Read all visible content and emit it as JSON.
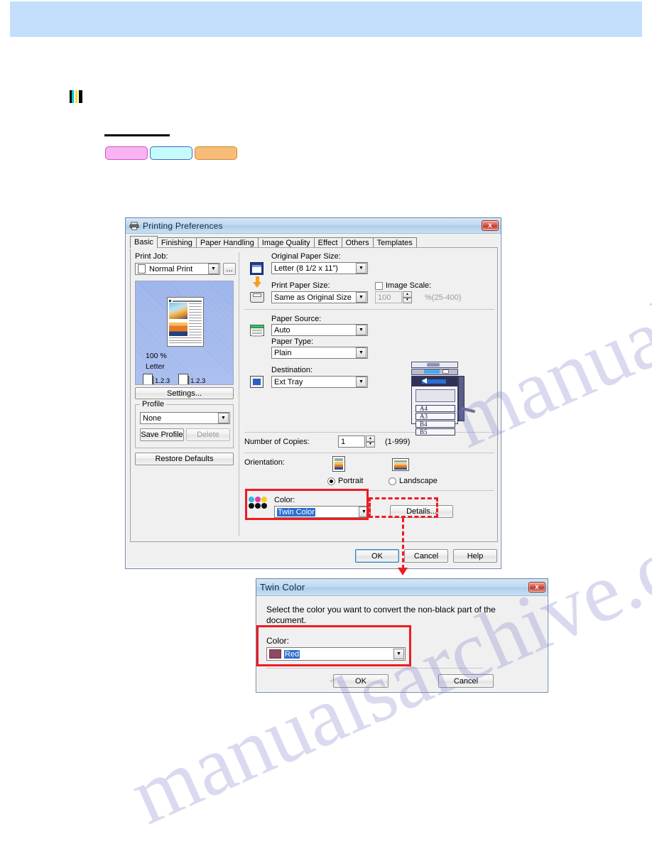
{
  "page": {
    "watermark": "manualsarchive.com",
    "cmyk_marker_colors": [
      "#00c2e0",
      "#f5e12a",
      "#000000",
      "#000000"
    ],
    "pills": [
      {
        "name": "pill-magenta",
        "fill": "#f8b3f2",
        "stroke": "#cf52c6"
      },
      {
        "name": "pill-cyan",
        "fill": "#c6fbfb",
        "stroke": "#4169c9"
      },
      {
        "name": "pill-orange",
        "fill": "#f7bd78",
        "stroke": "#d4872f"
      }
    ],
    "banner_color": "#c3dffb"
  },
  "printing_preferences": {
    "title": "Printing Preferences",
    "close_label": "x",
    "tabs": [
      {
        "label": "Basic",
        "active": true
      },
      {
        "label": "Finishing",
        "active": false
      },
      {
        "label": "Paper Handling",
        "active": false
      },
      {
        "label": "Image Quality",
        "active": false
      },
      {
        "label": "Effect",
        "active": false
      },
      {
        "label": "Others",
        "active": false
      },
      {
        "label": "Templates",
        "active": false
      }
    ],
    "print_job": {
      "label": "Print Job:",
      "value": "Normal Print",
      "more_button": "..."
    },
    "preview": {
      "zoom": "100 %",
      "paper": "Letter",
      "page_order_left": "1.2.3",
      "page_order_right": "1.2.3"
    },
    "settings_button": "Settings...",
    "profile": {
      "group_label": "Profile",
      "value": "None",
      "save_button": "Save Profile",
      "delete_button": "Delete"
    },
    "restore_defaults_button": "Restore Defaults",
    "original_paper_size": {
      "label": "Original Paper Size:",
      "value": "Letter (8 1/2 x 11\")"
    },
    "print_paper_size": {
      "label": "Print Paper Size:",
      "value": "Same as Original Size"
    },
    "image_scale": {
      "label": "Image Scale:",
      "checked": false,
      "value": "100",
      "range": "%(25-400)"
    },
    "paper_source": {
      "label": "Paper Source:",
      "value": "Auto"
    },
    "paper_type": {
      "label": "Paper Type:",
      "value": "Plain"
    },
    "destination": {
      "label": "Destination:",
      "value": "Ext Tray"
    },
    "printer_trays": [
      "A4",
      "A3",
      "B4",
      "B5"
    ],
    "number_of_copies": {
      "label": "Number of Copies:",
      "value": "1",
      "range": "(1-999)"
    },
    "orientation": {
      "label": "Orientation:",
      "portrait": "Portrait",
      "landscape": "Landscape",
      "selected": "Portrait"
    },
    "color": {
      "label": "Color:",
      "value": "Twin Color",
      "details_button": "Details..."
    },
    "footer": {
      "ok": "OK",
      "cancel": "Cancel",
      "help": "Help"
    }
  },
  "twin_color_dialog": {
    "title": "Twin Color",
    "close_label": "x",
    "description": "Select the color you want to convert the non-black part of the document.",
    "color": {
      "label": "Color:",
      "value": "Red",
      "swatch_hex": "#8e4a63"
    },
    "footer": {
      "ok": "OK",
      "cancel": "Cancel"
    }
  }
}
